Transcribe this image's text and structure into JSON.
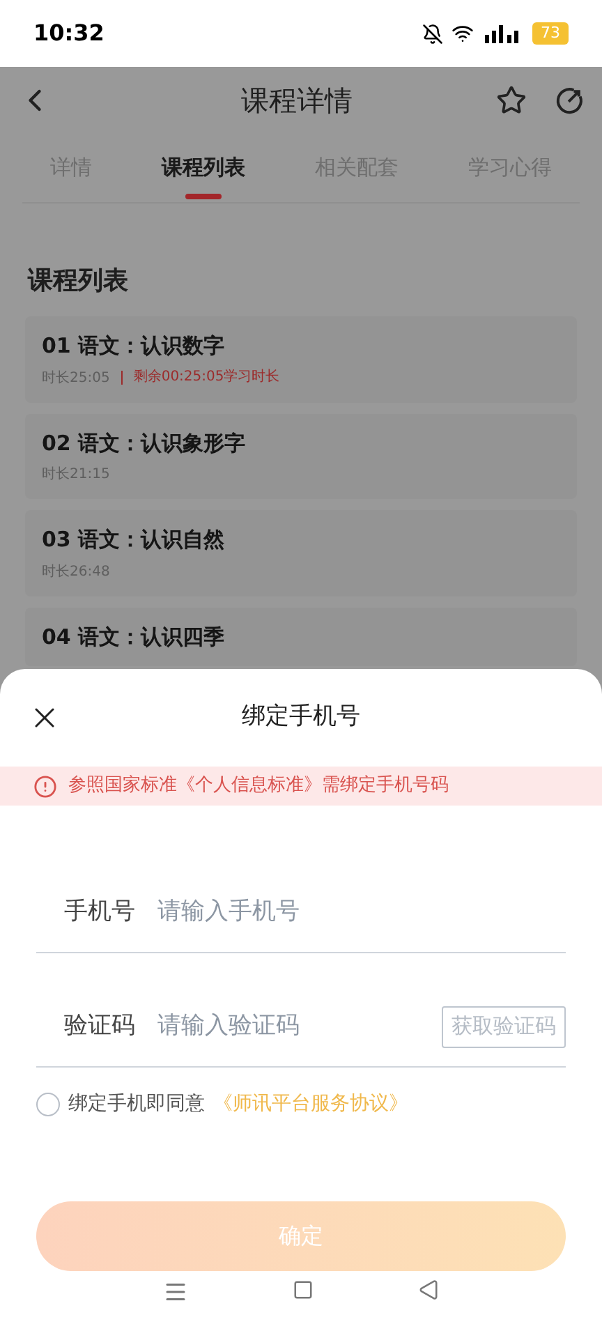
{
  "status_bar": {
    "time": "10:32",
    "battery": "73"
  },
  "header": {
    "title": "课程详情"
  },
  "tabs": [
    {
      "label": "详情",
      "selected": false
    },
    {
      "label": "课程列表",
      "selected": true
    },
    {
      "label": "相关配套",
      "selected": false
    },
    {
      "label": "学习心得",
      "selected": false
    }
  ],
  "list": {
    "heading": "课程列表",
    "items": [
      {
        "title": "01 语文：认识数字",
        "duration": "时长25:05",
        "remaining": "剩余00:25:05学习时长"
      },
      {
        "title": "02 语文：认识象形字",
        "duration": "时长21:15"
      },
      {
        "title": "03 语文：认识自然",
        "duration": "时长26:48"
      },
      {
        "title": "04 语文：认识四季"
      }
    ]
  },
  "sheet": {
    "title": "绑定手机号",
    "notice": "参照国家标准《个人信息标准》需绑定手机号码",
    "fields": [
      {
        "label": "手机号",
        "placeholder": "请输入手机号"
      },
      {
        "label": "验证码",
        "placeholder": "请输入验证码",
        "action": "获取验证码"
      }
    ],
    "agreement": {
      "checked": false,
      "text": "绑定手机即同意",
      "link": "《师讯平台服务协议》"
    },
    "confirm": {
      "label": "确定",
      "disabled": true
    }
  }
}
